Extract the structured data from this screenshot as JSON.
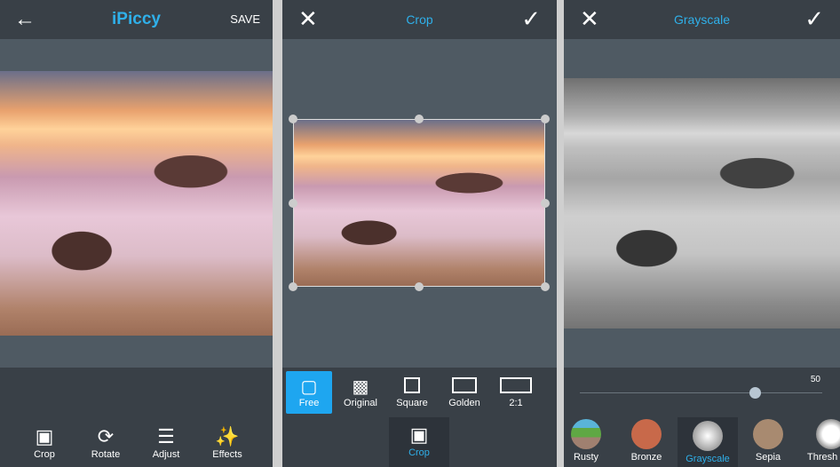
{
  "panel1": {
    "title": "iPiccy",
    "save": "SAVE",
    "tools": [
      {
        "label": "Crop",
        "icon": "crop-icon"
      },
      {
        "label": "Rotate",
        "icon": "rotate-icon"
      },
      {
        "label": "Adjust",
        "icon": "sliders-icon"
      },
      {
        "label": "Effects",
        "icon": "magic-wand-icon"
      }
    ]
  },
  "panel2": {
    "title": "Crop",
    "ratios": [
      "Free",
      "Original",
      "Square",
      "Golden",
      "2:1"
    ],
    "active_tool": "Crop"
  },
  "panel3": {
    "title": "Grayscale",
    "slider_value": "50",
    "slider_fraction": 0.72,
    "filters": [
      "Rusty",
      "Bronze",
      "Grayscale",
      "Sepia",
      "Thresh"
    ],
    "active_filter": "Grayscale"
  },
  "colors": {
    "accent": "#2fb0ea",
    "header": "#394047",
    "canvas": "#4f5a63"
  }
}
